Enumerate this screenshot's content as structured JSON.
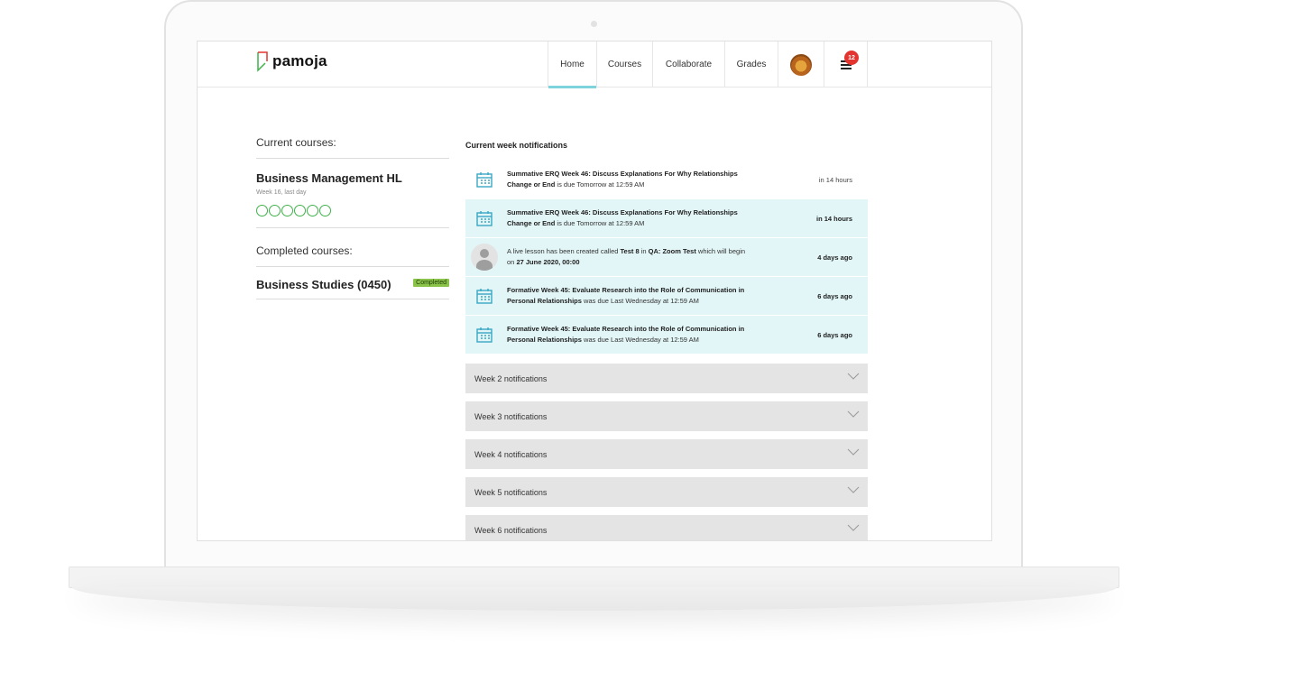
{
  "app": {
    "logo_text": "pamoja"
  },
  "nav": {
    "items": [
      {
        "label": "Home",
        "active": true
      },
      {
        "label": "Courses",
        "active": false
      },
      {
        "label": "Collaborate",
        "active": false
      },
      {
        "label": "Grades",
        "active": false
      }
    ],
    "avatar_icon": "lion-avatar",
    "menu_icon": "hamburger-menu-icon",
    "notification_count": "12"
  },
  "current_courses": {
    "heading": "Current courses:",
    "courses": [
      {
        "name": "Business Management HL",
        "meta": "Week 16, last day",
        "progress_total": 6,
        "progress_done": 0
      }
    ]
  },
  "completed_courses": {
    "heading": "Completed courses:",
    "courses": [
      {
        "name": "Business Studies (0450)",
        "badge": "Completed"
      }
    ]
  },
  "notifications": {
    "title": "Current week notifications",
    "items": [
      {
        "icon": "calendar-icon",
        "text_bold": "Summative ERQ Week 46: Discuss Explanations For Why Relationships Change or End",
        "text_rest": " is due Tomorrow at 12:59 AM",
        "time": "in 14 hours",
        "highlight": false
      },
      {
        "icon": "calendar-icon",
        "text_bold": "Summative ERQ Week 46: Discuss Explanations For Why Relationships Change or End",
        "text_rest": " is due Tomorrow at 12:59 AM",
        "time": "in 14 hours",
        "highlight": true
      },
      {
        "icon": "person-icon",
        "text_pre": "A live lesson has been created called ",
        "text_bold1": "Test 8",
        "text_mid": " in ",
        "text_bold2": "QA: Zoom Test",
        "text_mid2": " which will begin on ",
        "text_bold3": "27 June 2020, 00:00",
        "time": "4 days ago",
        "highlight": true
      },
      {
        "icon": "calendar-icon",
        "text_bold": "Formative Week 45: Evaluate Research into the Role of Communication in Personal Relationships",
        "text_rest": " was due Last Wednesday at 12:59 AM",
        "time": "6 days ago",
        "highlight": true
      },
      {
        "icon": "calendar-icon",
        "text_bold": "Formative Week 45: Evaluate Research into the Role of Communication in Personal Relationships",
        "text_rest": " was due Last Wednesday at 12:59 AM",
        "time": "6 days ago",
        "highlight": true
      }
    ]
  },
  "weeks": [
    {
      "label": "Week 2 notifications"
    },
    {
      "label": "Week 3 notifications"
    },
    {
      "label": "Week 4 notifications"
    },
    {
      "label": "Week 5 notifications"
    },
    {
      "label": "Week 6 notifications"
    }
  ],
  "colors": {
    "accent": "#7fd3dc",
    "highlight_bg": "#e2f5f7",
    "progress_green": "#3fb24a",
    "badge_green": "#8bc34a",
    "badge_red": "#e3342f",
    "calendar_blue": "#3aa7c4"
  }
}
